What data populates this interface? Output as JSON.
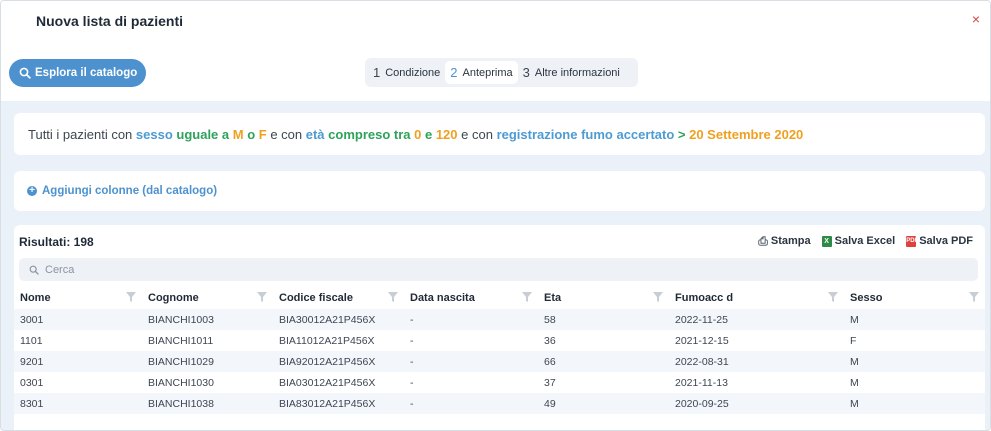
{
  "modal": {
    "title": "Nuova lista di pazienti",
    "close_label": "×"
  },
  "toolbar": {
    "explore_label": "Esplora il catalogo"
  },
  "steps": [
    {
      "num": "1",
      "label": "Condizione",
      "active": false
    },
    {
      "num": "2",
      "label": "Anteprima",
      "active": true
    },
    {
      "num": "3",
      "label": "Altre informazioni",
      "active": false
    }
  ],
  "condition": {
    "parts": [
      {
        "text": "Tutti i pazienti con ",
        "style": "plain"
      },
      {
        "text": "sesso ",
        "style": "blue"
      },
      {
        "text": "uguale a ",
        "style": "green"
      },
      {
        "text": "M ",
        "style": "orange"
      },
      {
        "text": "o ",
        "style": "green"
      },
      {
        "text": "F",
        "style": "orange"
      },
      {
        "text": " e con ",
        "style": "plain"
      },
      {
        "text": "età ",
        "style": "blue"
      },
      {
        "text": "compreso tra ",
        "style": "green"
      },
      {
        "text": "0 ",
        "style": "orange"
      },
      {
        "text": "e ",
        "style": "green"
      },
      {
        "text": "120",
        "style": "orange"
      },
      {
        "text": " e con ",
        "style": "plain"
      },
      {
        "text": "registrazione fumo accertato ",
        "style": "blue"
      },
      {
        "text": "> ",
        "style": "green"
      },
      {
        "text": "20 Settembre 2020",
        "style": "orange"
      }
    ]
  },
  "add_columns": {
    "icon": "plus-circle-icon",
    "label": "Aggiungi colonne (dal catalogo)"
  },
  "results": {
    "title": "Risultati: 198",
    "print_label": "Stampa",
    "excel_label": "Salva Excel",
    "pdf_label": "Salva PDF",
    "search_placeholder": "Cerca",
    "columns": [
      "Nome",
      "Cognome",
      "Codice fiscale",
      "Data nascita",
      "Eta",
      "Fumoacc d",
      "Sesso"
    ],
    "rows": [
      [
        "3001",
        "BIANCHI1003",
        "BIA30012A21P456X",
        "-",
        "58",
        "2022-11-25",
        "M"
      ],
      [
        "1101",
        "BIANCHI1011",
        "BIA11012A21P456X",
        "-",
        "36",
        "2021-12-15",
        "F"
      ],
      [
        "9201",
        "BIANCHI1029",
        "BIA92012A21P456X",
        "-",
        "66",
        "2022-08-31",
        "M"
      ],
      [
        "0301",
        "BIANCHI1030",
        "BIA03012A21P456X",
        "-",
        "37",
        "2021-11-13",
        "M"
      ],
      [
        "8301",
        "BIANCHI1038",
        "BIA83012A21P456X",
        "-",
        "49",
        "2020-09-25",
        "M"
      ]
    ]
  },
  "colors": {
    "accent": "#4d92cf",
    "green": "#2ea15b",
    "orange": "#f0a020",
    "close": "#e0413c",
    "content_bg": "#eaf1f9"
  }
}
